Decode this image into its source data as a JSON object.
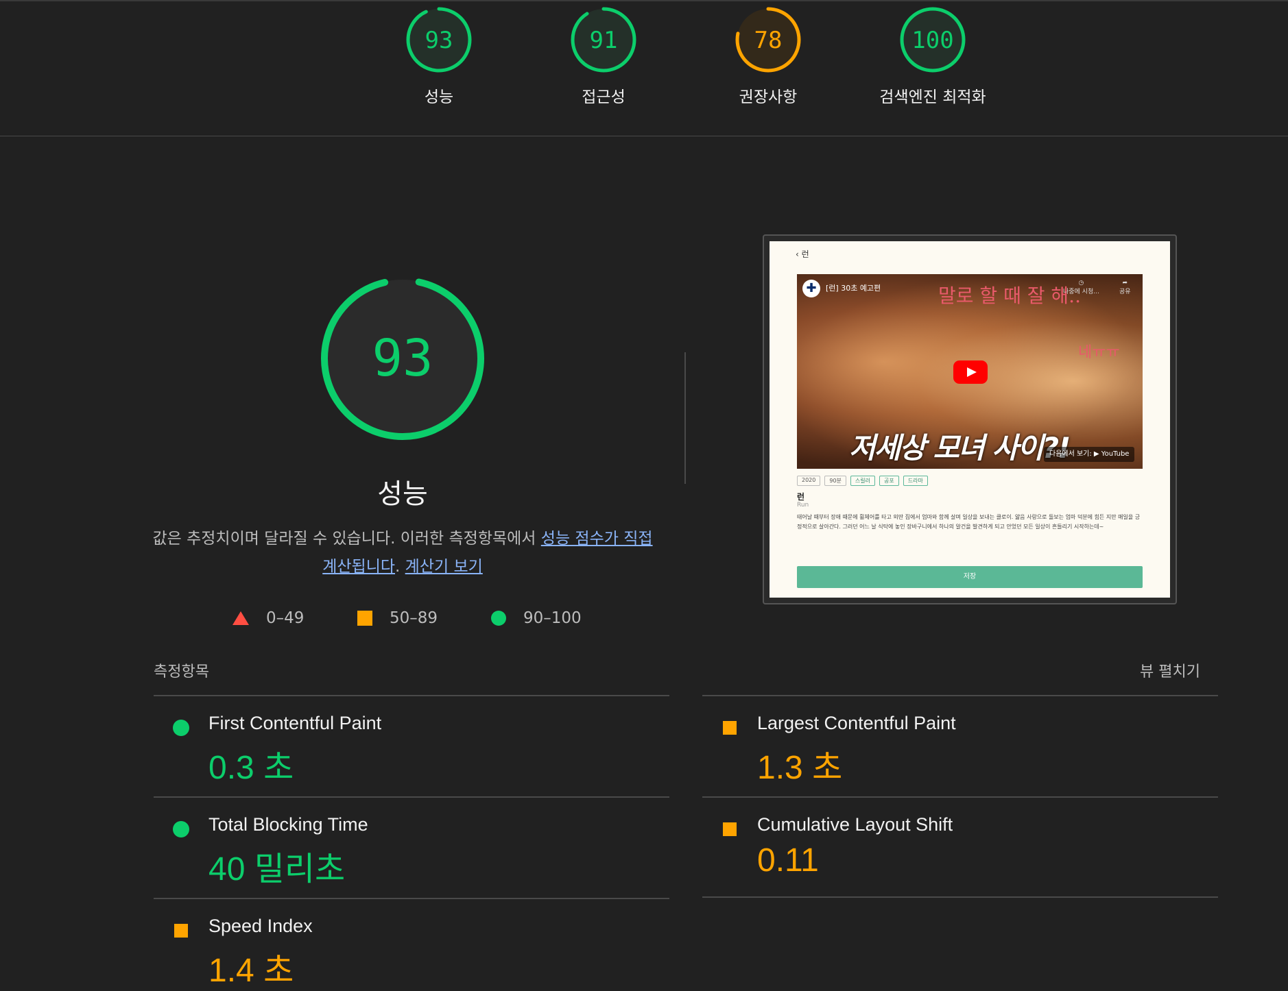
{
  "gauges": [
    {
      "score": "93",
      "label": "성능",
      "rating": "pass"
    },
    {
      "score": "91",
      "label": "접근성",
      "rating": "pass"
    },
    {
      "score": "78",
      "label": "권장사항",
      "rating": "average"
    },
    {
      "score": "100",
      "label": "검색엔진 최적화",
      "rating": "pass"
    }
  ],
  "performance": {
    "score": "93",
    "title": "성능",
    "description": "값은 추정치이며 달라질 수 있습니다. 이러한 측정항목에서 ",
    "link1": "성능 점수가 직접 계산됩니다",
    "sep": ". ",
    "link2": "계산기 보기"
  },
  "legend": [
    {
      "range": "0–49",
      "shape": "triangle",
      "color": "#ff4e42"
    },
    {
      "range": "50–89",
      "shape": "square",
      "color": "#ffa400"
    },
    {
      "range": "90–100",
      "shape": "circle",
      "color": "#0cce6b"
    }
  ],
  "thumbnail": {
    "back_label": "‹ 런",
    "video_title": "[런] 30초 예고편",
    "caption_top": "말로 할 때 잘 해..",
    "caption_side": "네ㅠㅠ",
    "watch_later": "나중에 시청...",
    "share": "공유",
    "caption_big": "저세상 모녀 사이?!",
    "youtube": "다음에서 보기:  ▶ YouTube",
    "tags": [
      "2020",
      "90분",
      "스릴러",
      "공포",
      "드라마"
    ],
    "movie_name": "런",
    "movie_sub": "Run",
    "synopsis": "태어날 때부터 장애 때문에 휠체어를 타고 외딴 집에서 엄마와 함께 살며 일상을 보내는 클로이. 얇음 사랑으로 돌보는 엄마 덕분에 힘든 지만 매일을 긍정적으로 살아간다. 그러던 어느 날 식탁에 놓인 장바구니에서 하나의 알건을 발견하게 되고 안었던 모든 일상이 흔들리기 시작하는데~",
    "button": "저장"
  },
  "metrics": {
    "header": "측정항목",
    "expand": "뷰 펼치기",
    "items": [
      {
        "name": "First Contentful Paint",
        "value": "0.3 초",
        "rating": "pass"
      },
      {
        "name": "Largest Contentful Paint",
        "value": "1.3 초",
        "rating": "average"
      },
      {
        "name": "Total Blocking Time",
        "value": "40 밀리초",
        "rating": "pass"
      },
      {
        "name": "Cumulative Layout Shift",
        "value": "0.11",
        "rating": "average"
      },
      {
        "name": "Speed Index",
        "value": "1.4 초",
        "rating": "average"
      }
    ]
  },
  "colors": {
    "pass": "#0cce6b",
    "average": "#ffa400",
    "fail": "#ff4e42",
    "background": "#212121"
  }
}
